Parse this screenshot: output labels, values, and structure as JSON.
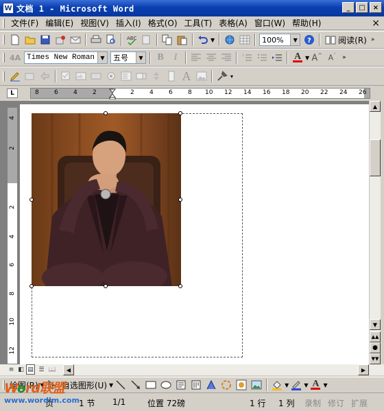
{
  "window": {
    "title": "文档 1 - Microsoft Word",
    "app_icon": "word-icon"
  },
  "window_controls": {
    "minimize": "_",
    "maximize": "□",
    "close": "×"
  },
  "menu": {
    "items": [
      "文件(F)",
      "编辑(E)",
      "视图(V)",
      "插入(I)",
      "格式(O)",
      "工具(T)",
      "表格(A)",
      "窗口(W)",
      "帮助(H)"
    ],
    "close_doc": "×"
  },
  "standard_toolbar": {
    "zoom": "100%",
    "read_label": "阅读(R)"
  },
  "format_toolbar": {
    "font_name": "Times New Roman",
    "font_size": "五号",
    "bold": "B",
    "italic": "I",
    "font_color_letter": "A",
    "font_color": "#e00000"
  },
  "ruler": {
    "corner": "L",
    "h_marks": [
      "8",
      "6",
      "4",
      "2",
      "2",
      "4",
      "6",
      "8",
      "10",
      "12",
      "14",
      "16",
      "18",
      "20",
      "22",
      "24",
      "26"
    ],
    "v_marks": [
      "4",
      "2",
      "2",
      "4",
      "6",
      "8",
      "10",
      "12"
    ]
  },
  "drawing_toolbar": {
    "draw_label": "绘图(R)",
    "autoshape_label": "自选图形(U)",
    "font_color_letter": "A"
  },
  "status_bar": {
    "page": "页",
    "section": "1 节",
    "page_of": "1/1",
    "position": "位置 72磅",
    "line": "1 行",
    "column": "1 列",
    "rec": "录制",
    "trk": "修订",
    "ext": "扩展"
  },
  "watermark": {
    "title_part1": "W",
    "title_part2": "o",
    "title_part3": "rd联盟",
    "url": "www.wordlm.com"
  }
}
